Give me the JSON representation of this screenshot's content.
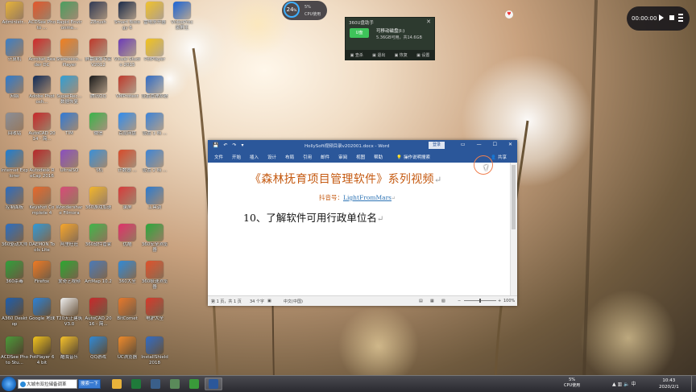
{
  "desktop_icons": [
    {
      "label": "Administr...",
      "color": "#e9b53a",
      "name": "admin-icon"
    },
    {
      "label": "ACDSee Photo ...",
      "color": "#e5572b",
      "name": "acdsee-icon"
    },
    {
      "label": "Rapid Environme...",
      "color": "#4aa060",
      "name": "rapid-icon"
    },
    {
      "label": "ZBrush",
      "color": "#303a55",
      "name": "zbrush-icon"
    },
    {
      "label": "Smart Biology 6",
      "color": "#1b2b4a",
      "name": "smart-biology-icon"
    },
    {
      "label": "雷电多开器",
      "color": "#f2c42c",
      "name": "leidian-icon"
    },
    {
      "label": "VideoProc 录屏王",
      "color": "#1b64d8",
      "name": "videoproc-icon"
    },
    {
      "label": "计算机",
      "color": "#3c80c8",
      "name": "computer-icon"
    },
    {
      "label": "Acrobat Reader DC",
      "color": "#d12b2b",
      "name": "acrobat-icon"
    },
    {
      "label": "Stereosco... Player",
      "color": "#f28020",
      "name": "stereo-icon"
    },
    {
      "label": "屏幕录像专家 V2012",
      "color": "#c0392b",
      "name": "screen-recorder-icon"
    },
    {
      "label": "Visual Studio 2015",
      "color": "#6c3bb8",
      "name": "visual-studio-icon"
    },
    {
      "label": "PotPlayer",
      "color": "#f3c41c",
      "name": "potplayer-icon"
    },
    {
      "label": "网络",
      "color": "#2c7bd0",
      "name": "network-icon"
    },
    {
      "label": "Adobe Photosh...",
      "color": "#0f2a58",
      "name": "photoshop-icon"
    },
    {
      "label": "SuperRec... 数据恢复",
      "color": "#2fa0d8",
      "name": "superrec-icon"
    },
    {
      "label": "腾讯QQ",
      "color": "#1a1a1a",
      "name": "qq-icon"
    },
    {
      "label": "VMProtect",
      "color": "#c0392b",
      "name": "vmprotect-icon"
    },
    {
      "label": "设置管理系统",
      "color": "#2f6cc8",
      "name": "settings-system-icon"
    },
    {
      "label": "回收站",
      "color": "#8a8f99",
      "name": "recycle-bin-icon"
    },
    {
      "label": "AutoCAD 2014 - 简...",
      "color": "#c8282a",
      "name": "autocad-icon"
    },
    {
      "label": "TIM",
      "color": "#2f7ad8",
      "name": "tim-icon"
    },
    {
      "label": "微信",
      "color": "#39b54a",
      "name": "wechat-icon"
    },
    {
      "label": "百度网盘",
      "color": "#2f8cf0",
      "name": "baidu-pan-icon"
    },
    {
      "label": "设置 1 档 ...",
      "color": "#3b82d8",
      "name": "setting1-icon"
    },
    {
      "label": "Internet Explorer",
      "color": "#1d7fd4",
      "name": "ie-icon"
    },
    {
      "label": "Autodesk ReCap 2016",
      "color": "#b8282a",
      "name": "recap-icon"
    },
    {
      "label": "UltraISO",
      "color": "#8a4ec0",
      "name": "ultraiso-icon"
    },
    {
      "label": "飞机",
      "color": "#3a90d8",
      "name": "plane-icon"
    },
    {
      "label": "计数器 ...",
      "color": "#d84a2a",
      "name": "counter-icon"
    },
    {
      "label": "设置 2 档 ...",
      "color": "#3c84d6",
      "name": "setting2-icon"
    },
    {
      "label": "控制面板",
      "color": "#2c6cc0",
      "name": "control-panel-icon"
    },
    {
      "label": "Keyshot Complete 4",
      "color": "#e8682a",
      "name": "keyshot-icon"
    },
    {
      "label": "Wondershare Filmora",
      "color": "#d84a78",
      "name": "filmora-icon"
    },
    {
      "label": "360游戏加速",
      "color": "#f3b62a",
      "name": "game-booster-icon"
    },
    {
      "label": "录屏",
      "color": "#d83a3a",
      "name": "screen-rec-icon"
    },
    {
      "label": "工具调",
      "color": "#2a7ad0",
      "name": "tool-icon"
    },
    {
      "label": "360驱动大师",
      "color": "#2a6fc4",
      "name": "driver-master-icon"
    },
    {
      "label": "DAEMON Tools Lite",
      "color": "#2f9ad8",
      "name": "daemon-icon"
    },
    {
      "label": "阿里旺旺",
      "color": "#f7a62a",
      "name": "aliwangwang-icon"
    },
    {
      "label": "360软件管家",
      "color": "#3fb649",
      "name": "software-mgr-icon"
    },
    {
      "label": "优酷",
      "color": "#e0306a",
      "name": "youku-icon"
    },
    {
      "label": "360安全浏览器",
      "color": "#2aa83a",
      "name": "360-browser-icon"
    },
    {
      "label": "360杀毒",
      "color": "#2fa13a",
      "name": "360-antivirus-icon"
    },
    {
      "label": "Firefox",
      "color": "#f07a22",
      "name": "firefox-icon"
    },
    {
      "label": "爱奇艺视频",
      "color": "#2aa830",
      "name": "iqiyi-icon"
    },
    {
      "label": "ArtMap 10.2",
      "color": "#4a7ab8",
      "name": "artmap-icon"
    },
    {
      "label": "360大全",
      "color": "#2f8ad8",
      "name": "360-all-icon"
    },
    {
      "label": "360极速浏览器",
      "color": "#e0502a",
      "name": "360-speed-icon"
    },
    {
      "label": "A360 Desktop",
      "color": "#1d5fb0",
      "name": "a360-icon"
    },
    {
      "label": "Google 地球",
      "color": "#2a82d8",
      "name": "google-earth-icon"
    },
    {
      "label": "T20天正建筑 V3.0",
      "color": "#f0f0f0",
      "name": "t20-icon"
    },
    {
      "label": "AutoCAD 2016 - 简...",
      "color": "#c8282a",
      "name": "autocad2016-icon"
    },
    {
      "label": "BitComet",
      "color": "#e8782a",
      "name": "bitcomet-icon"
    },
    {
      "label": "电驴大全",
      "color": "#d8382a",
      "name": "edonkey-icon"
    },
    {
      "label": "ACDSee Photo Stu...",
      "color": "#4a9c3a",
      "name": "acdsee-studio-icon"
    },
    {
      "label": "PotPlayer 64 bit",
      "color": "#f3c41c",
      "name": "potplayer64-icon"
    },
    {
      "label": "酷我音乐",
      "color": "#f7c32a",
      "name": "kuwo-icon"
    },
    {
      "label": "QQ游戏",
      "color": "#2f8ad8",
      "name": "qq-game-icon"
    },
    {
      "label": "UC浏览器",
      "color": "#f08a2a",
      "name": "uc-browser-icon"
    },
    {
      "label": "InstallShield 2018",
      "color": "#2f6cc8",
      "name": "installshield-icon"
    }
  ],
  "cpu_gauge": {
    "percent": "24",
    "unit": "%",
    "usage": "5%",
    "label": "CPU使用"
  },
  "usb_popup": {
    "title": "360U盘助手",
    "close": "✕",
    "drive_label": "U盘",
    "drive_name": "可移动磁盘(I:)",
    "drive_info": "5.36GB可用，共14.6GB",
    "actions": [
      "▣ 查杀",
      "▣ 退出",
      "▣ 恢复",
      "▣ 设置"
    ]
  },
  "video_player": {
    "time": "00:00:00"
  },
  "word": {
    "title": "HollySoft视频目录v202001.docx - Word",
    "login": "登录",
    "qat": [
      "💾",
      "↶",
      "↷",
      "▾"
    ],
    "window_buttons": [
      "▭",
      "—",
      "☐",
      "✕"
    ],
    "tabs": [
      "文件",
      "开始",
      "插入",
      "设计",
      "布局",
      "引用",
      "邮件",
      "审阅",
      "视图",
      "帮助"
    ],
    "tell_me": "操作说明搜索",
    "share": "共享",
    "doc_title": "《森林抚育项目管理软件》系列视频",
    "sub_prefix": "抖音号：",
    "sub_link": "LightFromMars",
    "item": "10、了解软件可用行政单位名",
    "para_mark": "↵",
    "status": {
      "page": "第 1 页，共 1 页",
      "words": "34 个字",
      "lang": "中文(中国)",
      "zoom": "100%"
    }
  },
  "taskbar": {
    "search_text": "大城市双拉储备调革",
    "search_button": "搜索一下",
    "apps": [
      {
        "name": "explorer-taskbar-icon",
        "color": "#e8b23a"
      },
      {
        "name": "excel-taskbar-icon",
        "color": "#1f7a3a"
      },
      {
        "name": "media-taskbar-icon",
        "color": "#3a5f8a"
      },
      {
        "name": "app-taskbar-icon",
        "color": "#5a8a5a"
      },
      {
        "name": "chrome-taskbar-icon",
        "color": "#3a9a3a"
      },
      {
        "name": "word-taskbar-icon",
        "color": "#2b579a"
      }
    ],
    "cpu_value": "5%",
    "cpu_label": "CPU使用",
    "time": "10:43",
    "date": "2020/2/1"
  }
}
